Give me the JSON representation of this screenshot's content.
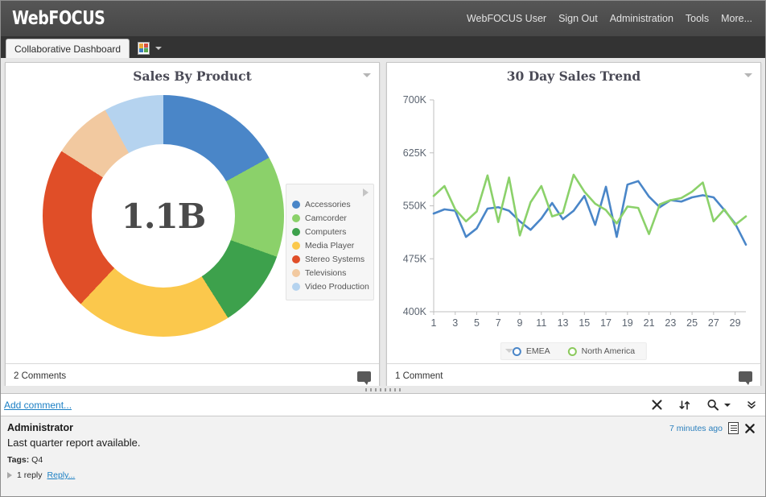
{
  "banner": {
    "logo": "WebFOCUS",
    "links": [
      {
        "label": "WebFOCUS User",
        "name": "banner-link-user"
      },
      {
        "label": "Sign Out",
        "name": "banner-link-signout"
      },
      {
        "label": "Administration",
        "name": "banner-link-administration"
      },
      {
        "label": "Tools",
        "name": "banner-link-tools"
      },
      {
        "label": "More...",
        "name": "banner-link-more"
      }
    ]
  },
  "tabbar": {
    "active_tab": "Collaborative Dashboard",
    "report_icon": "report-icon",
    "dropdown_icon": "chevron-down-icon"
  },
  "panels": [
    {
      "title": "Sales By Product",
      "menu_icon": "chevron-down-icon",
      "footer_text": "2 Comments",
      "footer_icon": "comment-bubble-icon"
    },
    {
      "title": "30 Day Sales Trend",
      "menu_icon": "chevron-down-icon",
      "footer_text": "1 Comment",
      "footer_icon": "comment-bubble-icon"
    }
  ],
  "chart_data": [
    {
      "type": "pie",
      "title": "Sales By Product",
      "center_label": "1.1B",
      "legend_position": "right",
      "categories": [
        "Accessories",
        "Camcorder",
        "Computers",
        "Media Player",
        "Stereo Systems",
        "Televisions",
        "Video Production"
      ],
      "values": [
        17.0,
        13.5,
        10.5,
        21.0,
        22.0,
        8.0,
        8.0
      ],
      "colors": [
        "#4a86c8",
        "#8bd16a",
        "#3da14c",
        "#fbc84c",
        "#e04e28",
        "#f2c9a0",
        "#b5d3ef"
      ],
      "units": "percent of total"
    },
    {
      "type": "line",
      "title": "30 Day Sales Trend",
      "xlabel": "",
      "ylabel": "",
      "ylim": [
        400000,
        700000
      ],
      "yticks": [
        400000,
        475000,
        550000,
        625000,
        700000
      ],
      "ytick_labels": [
        "400K",
        "475K",
        "550K",
        "625K",
        "700K"
      ],
      "x": [
        1,
        2,
        3,
        4,
        5,
        6,
        7,
        8,
        9,
        10,
        11,
        12,
        13,
        14,
        15,
        16,
        17,
        18,
        19,
        20,
        21,
        22,
        23,
        24,
        25,
        26,
        27,
        28,
        29,
        30
      ],
      "xtick_labels": [
        "1",
        "3",
        "5",
        "7",
        "9",
        "11",
        "13",
        "15",
        "17",
        "19",
        "21",
        "23",
        "25",
        "27",
        "29"
      ],
      "grid": false,
      "legend_position": "bottom",
      "series": [
        {
          "name": "EMEA",
          "color": "#4a86c8",
          "values": [
            539000,
            545000,
            543000,
            506000,
            518000,
            546000,
            548000,
            543000,
            528000,
            516000,
            532000,
            554000,
            531000,
            543000,
            564000,
            523000,
            577000,
            506000,
            580000,
            585000,
            563000,
            548000,
            558000,
            556000,
            562000,
            565000,
            562000,
            544000,
            525000,
            495000
          ]
        },
        {
          "name": "North America",
          "color": "#8bd16a",
          "values": [
            564000,
            578000,
            545000,
            528000,
            542000,
            593000,
            527000,
            590000,
            508000,
            555000,
            578000,
            535000,
            540000,
            594000,
            570000,
            553000,
            544000,
            525000,
            549000,
            547000,
            510000,
            552000,
            558000,
            561000,
            570000,
            583000,
            528000,
            545000,
            523000,
            535000
          ]
        }
      ]
    }
  ],
  "comments_pane": {
    "add_comment_label": "Add comment...",
    "tools": [
      {
        "name": "close-icon",
        "label": "Close"
      },
      {
        "name": "refresh-icon",
        "label": "Refresh"
      },
      {
        "name": "search-icon",
        "label": "Search"
      },
      {
        "name": "chevron-down-icon",
        "label": "Search options"
      },
      {
        "name": "collapse-all-icon",
        "label": "Collapse"
      }
    ],
    "items": [
      {
        "author": "Administrator",
        "time": "7 minutes ago",
        "text": "Last quarter report available.",
        "tags_label": "Tags:",
        "tags_value": "Q4",
        "replies_count": "1 reply",
        "reply_label": "Reply...",
        "edit_icon": "edit-document-icon",
        "delete_icon": "close-icon",
        "expand_icon": "expand-triangle-icon"
      }
    ]
  }
}
